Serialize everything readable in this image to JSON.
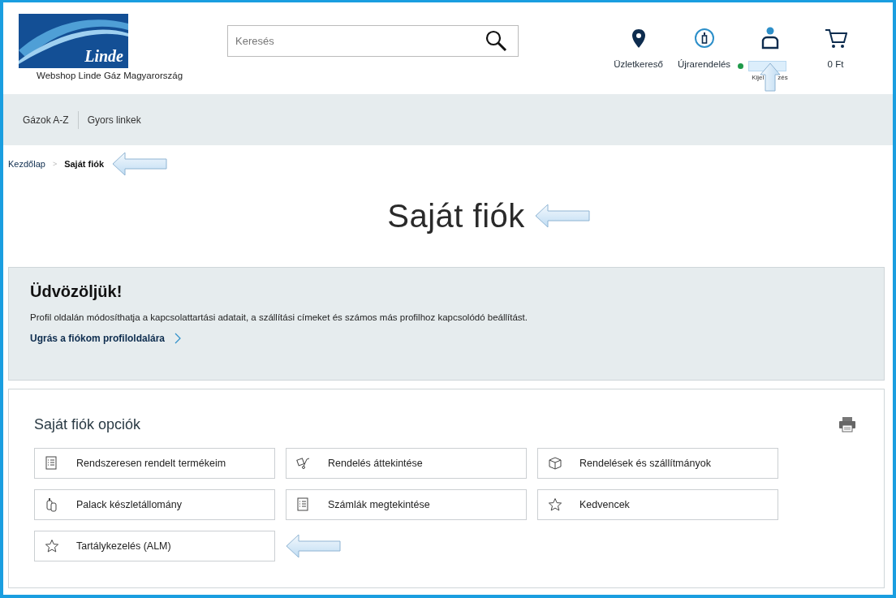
{
  "header": {
    "logo": "Linde",
    "subtitle": "Webshop Linde Gáz Magyarország",
    "search": {
      "placeholder": "Keresés"
    },
    "actions": [
      {
        "kind": "store",
        "label": "Üzletkereső"
      },
      {
        "kind": "reorder",
        "label": "Újrarendelés"
      },
      {
        "kind": "account",
        "label_start": "Kijel",
        "label_end": "zés",
        "online": true,
        "highlighted": true
      },
      {
        "kind": "cart",
        "label": "0 Ft"
      }
    ]
  },
  "nav": {
    "items": [
      "Gázok A-Z",
      "Gyors linkek"
    ]
  },
  "breadcrumb": {
    "separator": ">",
    "items": [
      {
        "label": "Kezdőlap",
        "current": false,
        "highlighted": false
      },
      {
        "label": "Saját fiók",
        "current": true,
        "highlighted": true
      }
    ]
  },
  "page_title": {
    "text": "Saját fiók",
    "highlighted": true
  },
  "welcome": {
    "title": "Üdvözöljük!",
    "text": "Profil oldalán módosíthatja a kapcsolattartási adatait, a szállítási címeket és számos más profilhoz kapcsolódó beállítást.",
    "link": "Ugrás a fiókom profiloldalára"
  },
  "options": {
    "title": "Saját fiók opciók",
    "items": [
      {
        "kind": "list",
        "label": "Rendszeresen rendelt termékeim",
        "highlighted": false
      },
      {
        "kind": "trolley",
        "label": "Rendelés áttekintése",
        "highlighted": false
      },
      {
        "kind": "package",
        "label": "Rendelések és szállítmányok",
        "highlighted": false
      },
      {
        "kind": "cylinder",
        "label": "Palack készletállomány",
        "highlighted": false
      },
      {
        "kind": "list",
        "label": "Számlák megtekintése",
        "highlighted": false
      },
      {
        "kind": "star",
        "label": "Kedvencek",
        "highlighted": false
      },
      {
        "kind": "star",
        "label": "Tartálykezelés (ALM)",
        "highlighted": true
      }
    ]
  }
}
